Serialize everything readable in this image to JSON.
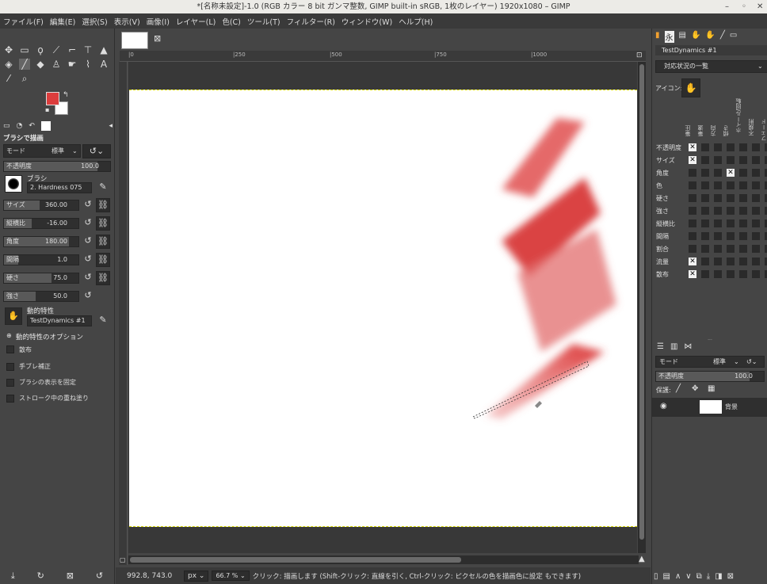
{
  "window": {
    "title": "*[名称未設定]-1.0 (RGB カラー 8 bit ガンマ整数, GIMP built-in sRGB, 1枚のレイヤー) 1920x1080 – GIMP"
  },
  "menu": [
    "ファイル(F)",
    "編集(E)",
    "選択(S)",
    "表示(V)",
    "画像(I)",
    "レイヤー(L)",
    "色(C)",
    "ツール(T)",
    "フィルター(R)",
    "ウィンドウ(W)",
    "ヘルプ(H)"
  ],
  "colors": {
    "foreground": "#dc3d3d",
    "background": "#ffffff",
    "accent": "#f0a030"
  },
  "tool_options": {
    "title": "ブラシで描画",
    "mode_label": "モード",
    "mode_value": "標準",
    "opacity_label": "不透明度",
    "opacity_value": "100.0",
    "brush_label": "ブラシ",
    "brush_value": "2. Hardness 075",
    "size_label": "サイズ",
    "size_value": "360.00",
    "aspect_label": "縦横比",
    "aspect_value": "-16.00",
    "angle_label": "角度",
    "angle_value": "180.00",
    "spacing_label": "間隔",
    "spacing_value": "1.0",
    "hardness_label": "硬さ",
    "hardness_value": "75.0",
    "force_label": "強さ",
    "force_value": "50.0",
    "dynamics_label": "動的特性",
    "dynamics_value": "TestDynamics #1",
    "dynamics_options": "動的特性のオプション",
    "scatter": "散布",
    "smooth": "手ブレ補正",
    "lock_brush": "ブラシの表示を固定",
    "incremental": "ストローク中の重ね塗り"
  },
  "ruler": {
    "h_ticks": [
      "|0",
      "|250",
      "|500",
      "|750",
      "|1000"
    ]
  },
  "status": {
    "coords": "992.8, 743.0",
    "unit": "px",
    "zoom": "66.7 %",
    "message": "クリック: 描画します (Shift-クリック: 直線を引く, Ctrl-クリック: ピクセルの色を描画色に設定 もできます)"
  },
  "dynamics_panel": {
    "name": "TestDynamics #1",
    "dropdown": "対応状況の一覧",
    "icon_label": "アイコン:",
    "columns": [
      "筆圧",
      "筆速",
      "方向",
      "傾き",
      "ホイール/回転",
      "不規則",
      "フェード"
    ],
    "rows": [
      "不透明度",
      "サイズ",
      "角度",
      "色",
      "硬さ",
      "強さ",
      "縦横比",
      "間隔",
      "割合",
      "流量",
      "散布"
    ],
    "checked": [
      [
        0,
        0
      ],
      [
        1,
        0
      ],
      [
        2,
        3
      ],
      [
        9,
        0
      ],
      [
        10,
        0
      ]
    ]
  },
  "layers": {
    "mode_label": "モード",
    "mode_value": "標準",
    "opacity_label": "不透明度",
    "opacity_value": "100.0",
    "lock_label": "保護:",
    "layer_name": "背景"
  }
}
